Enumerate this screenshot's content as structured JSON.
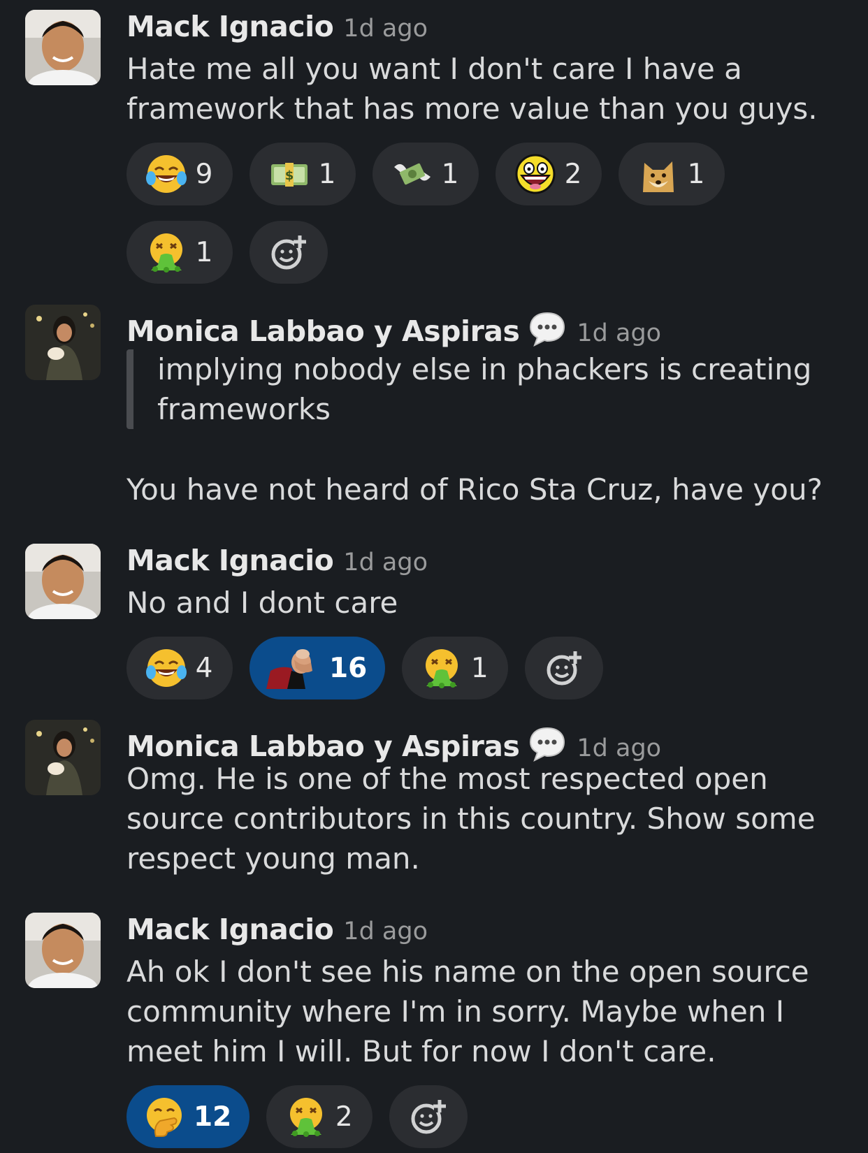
{
  "messages": [
    {
      "author": "Mack Ignacio",
      "time": "1d ago",
      "lines": [
        "Hate me all you want I don't care I have a",
        "framework that has more value than you guys."
      ],
      "reactions": [
        {
          "emoji": "joy-face-icon",
          "count": "9"
        },
        {
          "emoji": "dollar-bill-icon",
          "count": "1"
        },
        {
          "emoji": "money-wings-icon",
          "count": "1"
        },
        {
          "emoji": "epic-face-icon",
          "count": "2"
        },
        {
          "emoji": "doge-icon",
          "count": "1"
        },
        {
          "emoji": "vomit-face-icon",
          "count": "1"
        }
      ]
    },
    {
      "author": "Monica Labbao y Aspiras",
      "time": "1d ago",
      "quote_lines": [
        "implying nobody else in phackers is creating",
        "frameworks"
      ],
      "lines": [
        "You have not heard of Rico Sta Cruz, have you?"
      ]
    },
    {
      "author": "Mack Ignacio",
      "time": "1d ago",
      "lines": [
        "No and I dont care"
      ],
      "reactions": [
        {
          "emoji": "joy-face-icon",
          "count": "4"
        },
        {
          "emoji": "facepalm-picard-icon",
          "count": "16",
          "active": true
        },
        {
          "emoji": "vomit-face-icon",
          "count": "1"
        }
      ]
    },
    {
      "author": "Monica Labbao y Aspiras",
      "time": "1d ago",
      "lines": [
        "Omg. He is one of the most respected open",
        "source contributors in this country. Show some",
        "respect young man."
      ]
    },
    {
      "author": "Mack Ignacio",
      "time": "1d ago",
      "lines": [
        "Ah ok I don't see his name on the open source",
        "community where I'm in sorry. Maybe when I",
        "meet him I will. But for now I don't care."
      ],
      "reactions": [
        {
          "emoji": "hand-over-mouth-icon",
          "count": "12",
          "active": true
        },
        {
          "emoji": "vomit-face-icon",
          "count": "2"
        }
      ]
    }
  ],
  "icons": {
    "status": "speech-balloon-icon",
    "add_reaction": "add-reaction-icon"
  },
  "colors": {
    "background": "#1a1d21",
    "pill": "#2b2d31",
    "pill_active": "#0b4c8c"
  }
}
